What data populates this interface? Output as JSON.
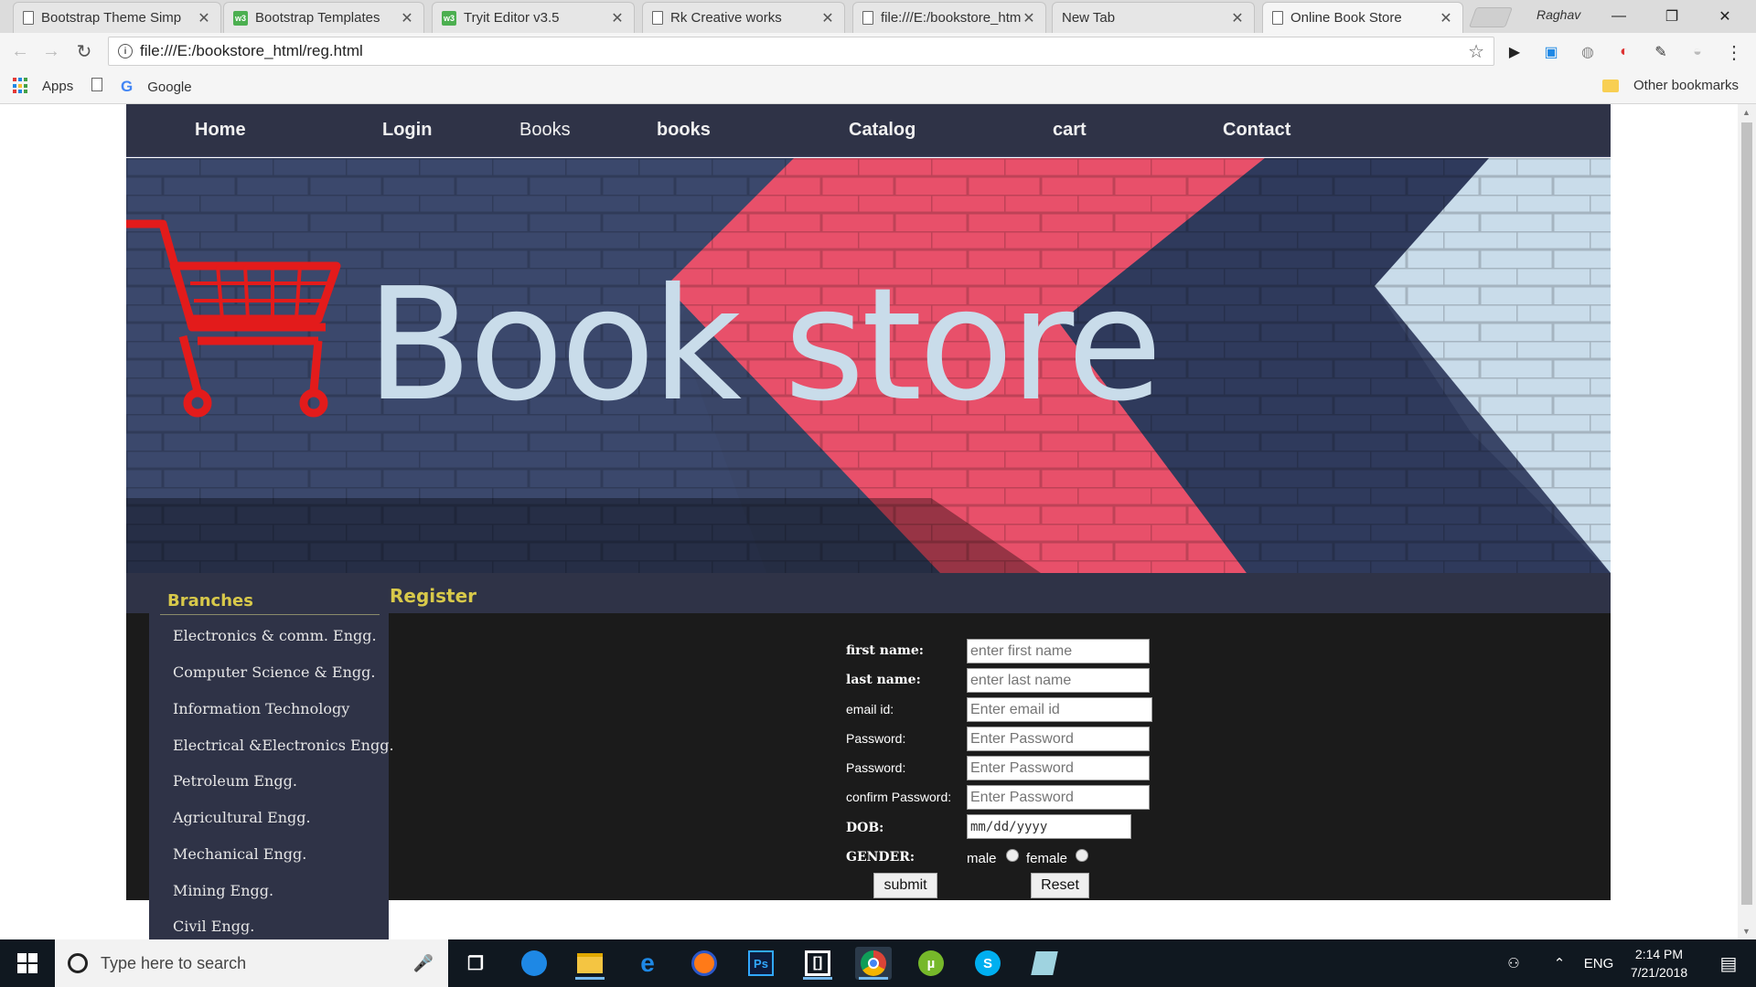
{
  "browser": {
    "tabs": [
      {
        "title": "Bootstrap Theme Simp",
        "icon": "page-icon"
      },
      {
        "title": "Bootstrap Templates",
        "icon": "w3schools-icon"
      },
      {
        "title": "Tryit Editor v3.5",
        "icon": "w3schools-icon"
      },
      {
        "title": "Rk Creative works",
        "icon": "page-icon"
      },
      {
        "title": "file:///E:/bookstore_htm",
        "icon": "page-icon"
      },
      {
        "title": "New Tab",
        "icon": "none"
      },
      {
        "title": "Online Book Store",
        "icon": "page-icon",
        "active": true
      }
    ],
    "profile_name": "Raghav",
    "url": "file:///E:/bookstore_html/reg.html",
    "bookmarks": {
      "apps_label": "Apps",
      "google_label": "Google",
      "other_label": "Other bookmarks"
    }
  },
  "site": {
    "nav": [
      "Home",
      "Login",
      "Books",
      "books",
      "Catalog",
      "cart",
      "Contact"
    ],
    "banner_title": "Book store",
    "sidebar": {
      "heading": "Branches",
      "items": [
        "Electronics & comm. Engg.",
        "Computer Science & Engg.",
        "Information Technology",
        "Electrical &Electronics Engg.",
        "Petroleum Engg.",
        "Agricultural Engg.",
        "Mechanical Engg.",
        "Mining Engg.",
        "Civil Engg."
      ]
    },
    "register": {
      "title": "Register",
      "fields": [
        {
          "label": "first name:",
          "placeholder": "enter first name"
        },
        {
          "label": "last name:",
          "placeholder": "enter last name"
        },
        {
          "label": "email id:",
          "placeholder": "Enter email id"
        },
        {
          "label": "Password:",
          "placeholder": "Enter Password"
        },
        {
          "label": "Password:",
          "placeholder": "Enter Password"
        },
        {
          "label": "confirm Password:",
          "placeholder": "Enter Password"
        }
      ],
      "dob_label": "DOB:",
      "dob_placeholder": "mm/dd/yyyy",
      "gender_label": "GENDER:",
      "gender_options": [
        "male",
        "female"
      ],
      "submit_label": "submit",
      "reset_label": "Reset"
    }
  },
  "taskbar": {
    "search_placeholder": "Type here to search",
    "language": "ENG",
    "time": "2:14 PM",
    "date": "7/21/2018"
  },
  "colors": {
    "nav_bg": "#2f3347",
    "accent_yellow": "#d8c94a",
    "content_bg": "#1b1b1b",
    "cart_red": "#e31b1b",
    "banner_pink": "#e8506a"
  }
}
